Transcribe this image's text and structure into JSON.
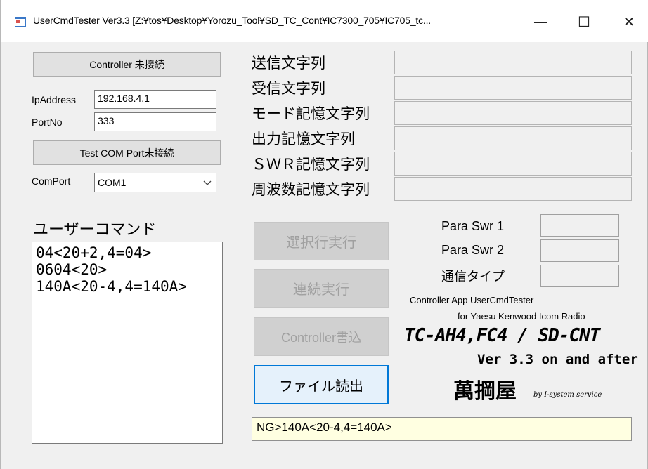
{
  "window": {
    "title": "UserCmdTester Ver3.3 [Z:¥tos¥Desktop¥Yorozu_Tool¥SD_TC_Cont¥IC7300_705¥IC705_tc...",
    "minimize_glyph": "—",
    "maximize_glyph": "☐",
    "close_glyph": "✕"
  },
  "controller": {
    "button_label": "Controller 未接続",
    "ip_label": "IpAddress",
    "ip_value": "192.168.4.1",
    "port_label": "PortNo",
    "port_value": "333"
  },
  "com": {
    "button_label": "Test COM Port未接続",
    "port_label": "ComPort",
    "port_value": "COM1"
  },
  "user_commands": {
    "label": "ユーザーコマンド",
    "text": "04<20+2,4=04>\n0604<20>\n140A<20-4,4=140A>"
  },
  "fields": [
    {
      "label": "送信文字列",
      "value": ""
    },
    {
      "label": "受信文字列",
      "value": ""
    },
    {
      "label": "モード記憶文字列",
      "value": ""
    },
    {
      "label": "出力記憶文字列",
      "value": ""
    },
    {
      "label": "ＳＷＲ記憶文字列",
      "value": ""
    },
    {
      "label": "周波数記憶文字列",
      "value": ""
    }
  ],
  "actions": {
    "run_selected": "選択行実行",
    "run_continuous": "連続実行",
    "controller_write": "Controller書込",
    "file_read": "ファイル読出"
  },
  "params": {
    "swr1_label": "Para Swr 1",
    "swr1_value": "",
    "swr2_label": "Para Swr 2",
    "swr2_value": "",
    "comm_type_label": "通信タイプ",
    "comm_type_value": ""
  },
  "info": {
    "line1": "Controller App UserCmdTester",
    "line2": "for Yaesu Kenwood Icom Radio",
    "product": "TC-AH4,FC4 / SD-CNT",
    "version": "Ver 3.3 on and after",
    "brand": "萬掆屋",
    "brand_sub": "by I-system service"
  },
  "status": {
    "text": "NG>140A<20-4,4=140A>"
  },
  "colors": {
    "accent": "#0078d7",
    "status_bg": "#ffffe1"
  }
}
